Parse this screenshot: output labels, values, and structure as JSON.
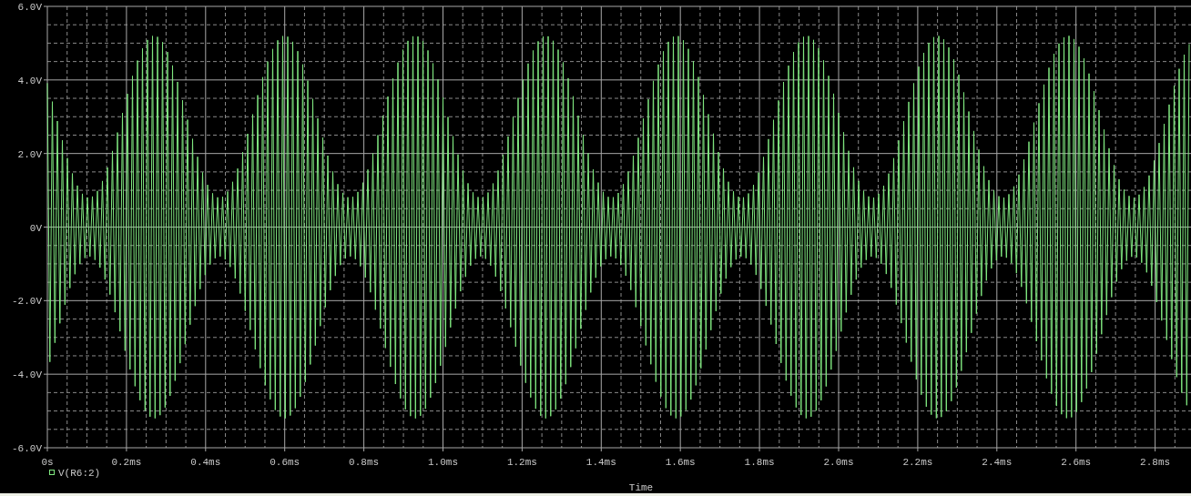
{
  "y_axis": {
    "ticks": [
      "6.0V",
      "4.0V",
      "2.0V",
      "0V",
      "-2.0V",
      "-4.0V",
      "-6.0V"
    ]
  },
  "x_axis": {
    "ticks": [
      "0s",
      "0.2ms",
      "0.4ms",
      "0.6ms",
      "0.8ms",
      "1.0ms",
      "1.2ms",
      "1.4ms",
      "1.6ms",
      "1.8ms",
      "2.0ms",
      "2.2ms",
      "2.4ms",
      "2.6ms",
      "2.8ms"
    ],
    "title": "Time"
  },
  "legend": {
    "label": "V(R6:2)"
  }
}
